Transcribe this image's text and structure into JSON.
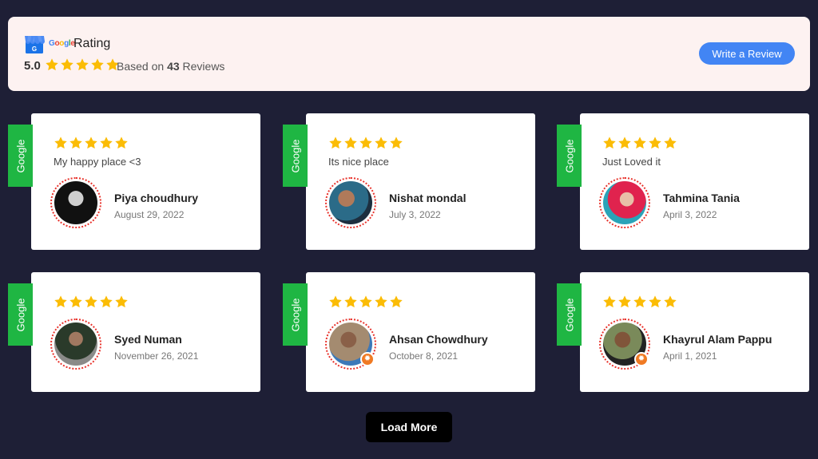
{
  "header": {
    "google_letters": [
      "G",
      "o",
      "o",
      "g",
      "l",
      "e"
    ],
    "title": "Rating",
    "score": "5.0",
    "stars": 5,
    "based_on_prefix": "Based on",
    "review_count": "43",
    "based_on_suffix": "Reviews",
    "write_review_label": "Write a Review"
  },
  "colors": {
    "background": "#1e1f36",
    "header_bg": "#fdf2f1",
    "accent_blue": "#4285f4",
    "star": "#fbbc05",
    "ribbon_green": "#1fb643",
    "avatar_ring": "#e8322b"
  },
  "reviews": [
    {
      "source": "Google",
      "rating": 5,
      "text": "My happy place <3",
      "name": "Piya choudhury",
      "date": "August 29, 2022",
      "badge": false
    },
    {
      "source": "Google",
      "rating": 5,
      "text": "Its nice place",
      "name": "Nishat mondal",
      "date": "July 3, 2022",
      "badge": false
    },
    {
      "source": "Google",
      "rating": 5,
      "text": "Just Loved it",
      "name": "Tahmina Tania",
      "date": "April 3, 2022",
      "badge": false
    },
    {
      "source": "Google",
      "rating": 5,
      "text": "",
      "name": "Syed Numan",
      "date": "November 26, 2021",
      "badge": false
    },
    {
      "source": "Google",
      "rating": 5,
      "text": "",
      "name": "Ahsan Chowdhury",
      "date": "October 8, 2021",
      "badge": true
    },
    {
      "source": "Google",
      "rating": 5,
      "text": "",
      "name": "Khayrul Alam Pappu",
      "date": "April 1, 2021",
      "badge": true
    }
  ],
  "load_more_label": "Load More"
}
